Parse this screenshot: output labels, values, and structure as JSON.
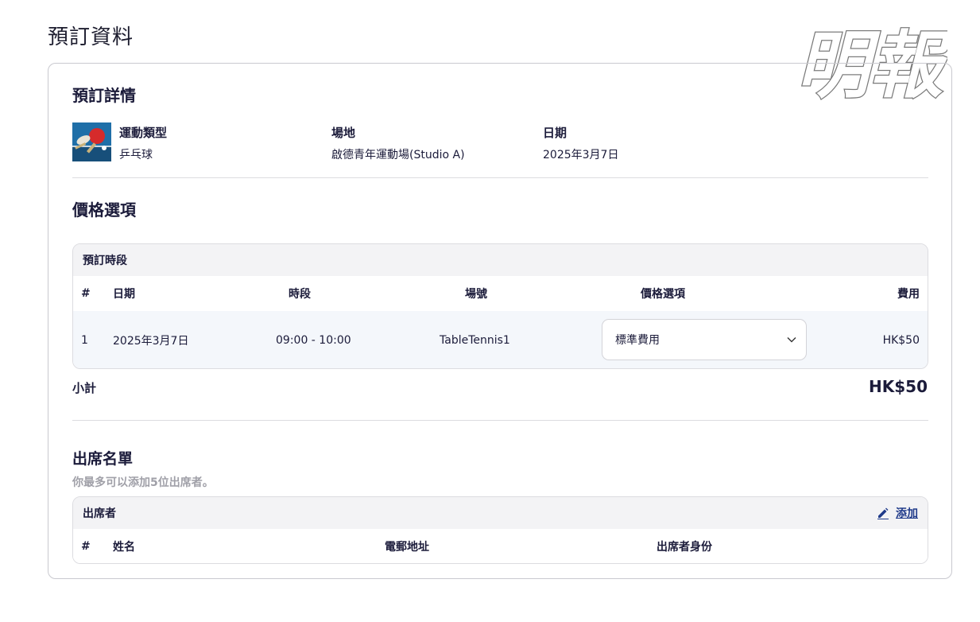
{
  "page": {
    "title": "預訂資料"
  },
  "watermark": {
    "text": "明報"
  },
  "details": {
    "title": "預訂詳情",
    "sport_label": "運動類型",
    "sport_value": "乒乓球",
    "venue_label": "場地",
    "venue_value": "啟德青年運動場(Studio A)",
    "date_label": "日期",
    "date_value": "2025年3月7日"
  },
  "pricing": {
    "title": "價格選項",
    "table_title": "預訂時段",
    "columns": [
      "#",
      "日期",
      "時段",
      "場號",
      "價格選項",
      "費用"
    ],
    "rows": [
      {
        "index": "1",
        "date": "2025年3月7日",
        "slot": "09:00 - 10:00",
        "court": "TableTennis1",
        "option": "標準費用",
        "fee": "HK$50"
      }
    ],
    "subtotal_label": "小計",
    "subtotal_value": "HK$50"
  },
  "attendees": {
    "title": "出席名單",
    "hint": "你最多可以添加5位出席者。",
    "table_title": "出席者",
    "add_label": "添加",
    "columns": [
      "#",
      "姓名",
      "電郵地址",
      "出席者身份"
    ]
  },
  "colors": {
    "text": "#1b1b3a",
    "link": "#1f3a8a",
    "hint": "#a0a0a8",
    "row_bg": "#f4f7fb"
  }
}
